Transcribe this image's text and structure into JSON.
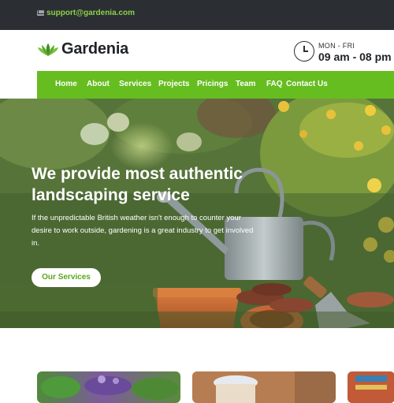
{
  "topbar": {
    "email": "support@gardenia.com",
    "icon": "mail-icon"
  },
  "header": {
    "brand": "Gardenia",
    "logo_icon": "leaf-logo-icon",
    "schedule_days": "MON - FRI",
    "schedule_hours": "09 am - 08 pm",
    "clock_icon": "clock-icon"
  },
  "nav": {
    "items": [
      "Home",
      "About",
      "Services",
      "Projects",
      "Pricings",
      "Team",
      "FAQ",
      "Contact Us"
    ]
  },
  "hero": {
    "title": "We provide most authentic landscaping service",
    "text": "If the unpredictable British weather isn't enough to counter your desire to work outside, gardening is a great industry to get involved in.",
    "button": "Our Services"
  },
  "colors": {
    "accent": "#66bd1f",
    "topbar": "#2b2e33",
    "email": "#8bd14a"
  }
}
